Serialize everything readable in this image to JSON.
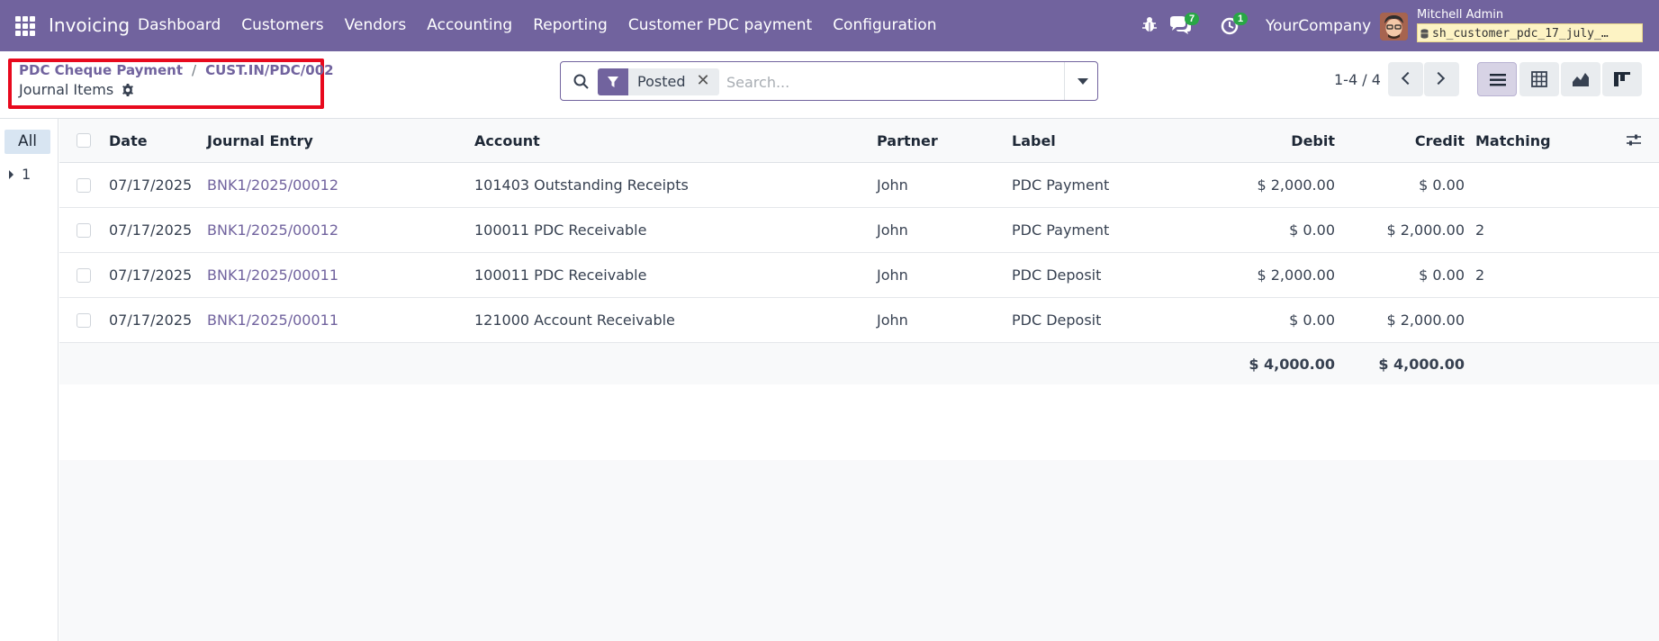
{
  "navbar": {
    "app_name": "Invoicing",
    "menu": [
      "Dashboard",
      "Customers",
      "Vendors",
      "Accounting",
      "Reporting",
      "Customer PDC payment",
      "Configuration"
    ],
    "chat_count": "7",
    "activity_count": "1",
    "company": "YourCompany",
    "user_name": "Mitchell Admin",
    "database": "sh_customer_pdc_17_july_…",
    "icons": [
      "apps-menu-icon",
      "bug-icon",
      "chat-icon",
      "activity-clock-icon",
      "avatar",
      "database-icon"
    ]
  },
  "breadcrumb": {
    "items": [
      "PDC Cheque Payment",
      "CUST.IN/PDC/002"
    ],
    "separator": "/",
    "current": "Journal Items"
  },
  "search": {
    "facet": "Posted",
    "facet_close": "✕",
    "placeholder": "Search..."
  },
  "pager": {
    "value": "1-4 / 4"
  },
  "views": [
    "list",
    "pivot",
    "graph",
    "kanban"
  ],
  "sidebar": {
    "all_label": "All",
    "group_label": "1"
  },
  "table": {
    "columns": [
      "Date",
      "Journal Entry",
      "Account",
      "Partner",
      "Label",
      "Debit",
      "Credit",
      "Matching"
    ],
    "rows": [
      {
        "date": "07/17/2025",
        "entry": "BNK1/2025/00012",
        "account": "101403 Outstanding Receipts",
        "partner": "John",
        "label": "PDC Payment",
        "debit": "$ 2,000.00",
        "credit": "$ 0.00",
        "matching": ""
      },
      {
        "date": "07/17/2025",
        "entry": "BNK1/2025/00012",
        "account": "100011 PDC Receivable",
        "partner": "John",
        "label": "PDC Payment",
        "debit": "$ 0.00",
        "credit": "$ 2,000.00",
        "matching": "2"
      },
      {
        "date": "07/17/2025",
        "entry": "BNK1/2025/00011",
        "account": "100011 PDC Receivable",
        "partner": "John",
        "label": "PDC Deposit",
        "debit": "$ 2,000.00",
        "credit": "$ 0.00",
        "matching": "2"
      },
      {
        "date": "07/17/2025",
        "entry": "BNK1/2025/00011",
        "account": "121000 Account Receivable",
        "partner": "John",
        "label": "PDC Deposit",
        "debit": "$ 0.00",
        "credit": "$ 2,000.00",
        "matching": ""
      }
    ],
    "totals": {
      "debit": "$ 4,000.00",
      "credit": "$ 4,000.00"
    }
  },
  "colors": {
    "navbar": "#71639e",
    "link": "#71639e",
    "highlight_border": "#e8091d",
    "badge": "#28a745"
  }
}
